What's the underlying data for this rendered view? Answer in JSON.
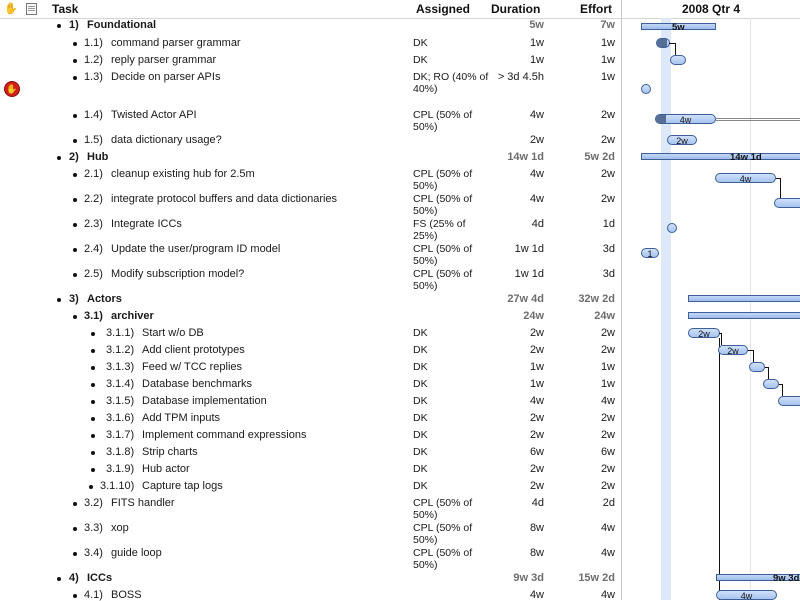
{
  "header": {
    "task": "Task",
    "assigned": "Assigned",
    "duration": "Duration",
    "effort": "Effort",
    "timeline_period": "2008 Qtr 4"
  },
  "rows": [
    {
      "num": "1)",
      "name": "Foundational",
      "assigned": "",
      "duration": "5w",
      "effort": "7w"
    },
    {
      "num": "1.1)",
      "name": "command parser grammar",
      "assigned": "DK",
      "duration": "1w",
      "effort": "1w"
    },
    {
      "num": "1.2)",
      "name": "reply parser grammar",
      "assigned": "DK",
      "duration": "1w",
      "effort": "1w"
    },
    {
      "num": "1.3)",
      "name": "Decide on parser APIs",
      "assigned": "DK; RO (40% of 40%)",
      "duration": "> 3d 4.5h",
      "effort": "1w"
    },
    {
      "num": "1.4)",
      "name": "Twisted Actor API",
      "assigned": "CPL (50% of 50%)",
      "duration": "4w",
      "effort": "2w"
    },
    {
      "num": "1.5)",
      "name": "data dictionary usage?",
      "assigned": "",
      "duration": "2w",
      "effort": "2w"
    },
    {
      "num": "2)",
      "name": "Hub",
      "assigned": "",
      "duration": "14w 1d",
      "effort": "5w 2d"
    },
    {
      "num": "2.1)",
      "name": "cleanup existing hub for 2.5m",
      "assigned": "CPL (50% of 50%)",
      "duration": "4w",
      "effort": "2w"
    },
    {
      "num": "2.2)",
      "name": "integrate protocol buffers and data dictionaries",
      "assigned": "CPL (50% of 50%)",
      "duration": "4w",
      "effort": "2w"
    },
    {
      "num": "2.3)",
      "name": "Integrate ICCs",
      "assigned": "FS (25% of 25%)",
      "duration": "4d",
      "effort": "1d"
    },
    {
      "num": "2.4)",
      "name": "Update the user/program ID model",
      "assigned": "CPL (50% of 50%)",
      "duration": "1w 1d",
      "effort": "3d"
    },
    {
      "num": "2.5)",
      "name": "Modify subscription model?",
      "assigned": "CPL (50% of 50%)",
      "duration": "1w 1d",
      "effort": "3d"
    },
    {
      "num": "3)",
      "name": "Actors",
      "assigned": "",
      "duration": "27w 4d",
      "effort": "32w 2d"
    },
    {
      "num": "3.1)",
      "name": "archiver",
      "assigned": "",
      "duration": "24w",
      "effort": "24w"
    },
    {
      "num": "3.1.1)",
      "name": "Start w/o DB",
      "assigned": "DK",
      "duration": "2w",
      "effort": "2w"
    },
    {
      "num": "3.1.2)",
      "name": "Add client prototypes",
      "assigned": "DK",
      "duration": "2w",
      "effort": "2w"
    },
    {
      "num": "3.1.3)",
      "name": "Feed w/ TCC replies",
      "assigned": "DK",
      "duration": "1w",
      "effort": "1w"
    },
    {
      "num": "3.1.4)",
      "name": "Database benchmarks",
      "assigned": "DK",
      "duration": "1w",
      "effort": "1w"
    },
    {
      "num": "3.1.5)",
      "name": "Database implementation",
      "assigned": "DK",
      "duration": "4w",
      "effort": "4w"
    },
    {
      "num": "3.1.6)",
      "name": "Add TPM inputs",
      "assigned": "DK",
      "duration": "2w",
      "effort": "2w"
    },
    {
      "num": "3.1.7)",
      "name": "Implement command expressions",
      "assigned": "DK",
      "duration": "2w",
      "effort": "2w"
    },
    {
      "num": "3.1.8)",
      "name": "Strip charts",
      "assigned": "DK",
      "duration": "6w",
      "effort": "6w"
    },
    {
      "num": "3.1.9)",
      "name": "Hub actor",
      "assigned": "DK",
      "duration": "2w",
      "effort": "2w"
    },
    {
      "num": "3.1.10)",
      "name": "Capture tap logs",
      "assigned": "DK",
      "duration": "2w",
      "effort": "2w"
    },
    {
      "num": "3.2)",
      "name": "FITS handler",
      "assigned": "CPL (50% of 50%)",
      "duration": "4d",
      "effort": "2d"
    },
    {
      "num": "3.3)",
      "name": "xop",
      "assigned": "CPL (50% of 50%)",
      "duration": "8w",
      "effort": "4w"
    },
    {
      "num": "3.4)",
      "name": "guide loop",
      "assigned": "CPL (50% of 50%)",
      "duration": "8w",
      "effort": "4w"
    },
    {
      "num": "4)",
      "name": "ICCs",
      "assigned": "",
      "duration": "9w 3d",
      "effort": "15w 2d"
    },
    {
      "num": "4.1)",
      "name": "BOSS",
      "assigned": "",
      "duration": "4w",
      "effort": "4w"
    }
  ],
  "gantt_labels": {
    "g1": "5w",
    "t14": "4w",
    "t15": "2w",
    "g2": "14w 1d",
    "t21": "4w",
    "t24": "1",
    "t311": "2w",
    "t312": "2w",
    "g4": "9w 3d",
    "t41": "4w"
  },
  "icons": {
    "hand": "hand-icon",
    "notes": "notes-icon",
    "stop": "stop-hand-icon"
  },
  "colors": {
    "bar_fill": "#a8c4ef",
    "bar_border": "#3d5f9a",
    "stop_icon": "#d0201a",
    "today_column": "#dde9f8"
  }
}
